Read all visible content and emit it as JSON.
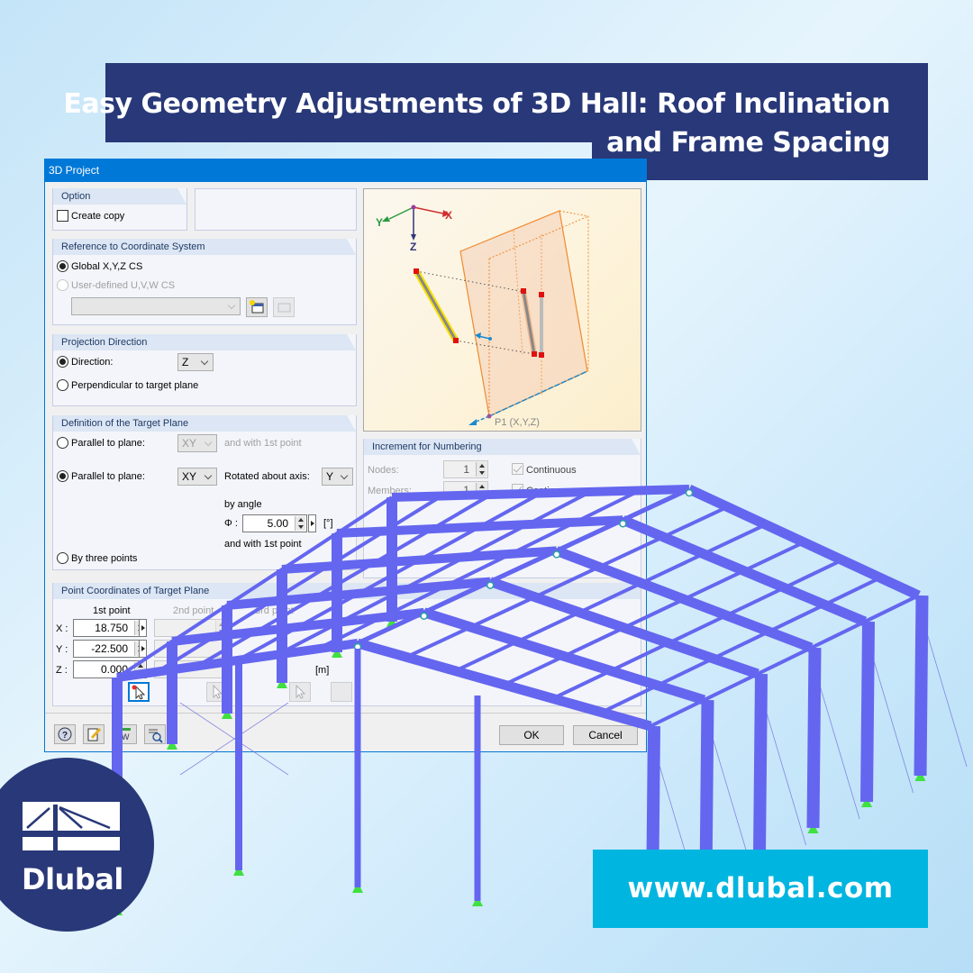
{
  "banner": {
    "line1": "Easy Geometry Adjustments of 3D Hall: Roof Inclination",
    "line2": "and Frame Spacing"
  },
  "dialog": {
    "title": "3D Project",
    "option": {
      "heading": "Option",
      "create_copy_label": "Create copy",
      "create_copy_checked": false
    },
    "coordinate_system": {
      "heading": "Reference to Coordinate System",
      "global_label": "Global X,Y,Z CS",
      "user_defined_label": "User-defined U,V,W CS",
      "selected": "global",
      "cs_select_value": ""
    },
    "projection": {
      "heading": "Projection Direction",
      "direction_label": "Direction:",
      "direction_value": "Z",
      "perpendicular_label": "Perpendicular to target plane",
      "selected": "direction"
    },
    "target_plane": {
      "heading": "Definition of the Target Plane",
      "option1_label": "Parallel to plane:",
      "option1_plane": "XY",
      "option1_suffix": "and with 1st point",
      "option2_label": "Parallel to plane:",
      "option2_plane": "XY",
      "rotated_label": "Rotated about axis:",
      "rotated_axis": "Y",
      "by_angle_label": "by angle",
      "phi_label": "Φ :",
      "angle_value": "5.00",
      "angle_unit": "[°]",
      "and_with_label": "and with 1st point",
      "option3_label": "By three points",
      "selected": "option2"
    },
    "point_coordinates": {
      "heading": "Point Coordinates of Target Plane",
      "columns": [
        "1st point",
        "2nd point",
        "3rd point"
      ],
      "rows": [
        {
          "axis": "X :",
          "p1": "18.750",
          "p2": "",
          "p3": ""
        },
        {
          "axis": "Y :",
          "p1": "-22.500",
          "p2": "",
          "p3": ""
        },
        {
          "axis": "Z :",
          "p1": "0.000",
          "p2": "",
          "p3": ""
        }
      ],
      "unit": "[m]"
    },
    "preview": {
      "axis_x": "X",
      "axis_y": "Y",
      "axis_z": "Z",
      "point_label": "P1 (X,Y,Z)"
    },
    "numbering": {
      "heading": "Increment for Numbering",
      "nodes_label": "Nodes:",
      "nodes_value": "1",
      "members_label": "Members:",
      "members_value": "1",
      "continuous_label": "Continuous",
      "nodes_continuous": true,
      "members_continuous": true
    },
    "buttons": {
      "ok": "OK",
      "cancel": "Cancel"
    }
  },
  "colors": {
    "brand_navy": "#283878",
    "brand_cyan": "#00b5e0",
    "member_blue": "#6466f0",
    "titlebar": "#0078d7"
  },
  "logo": {
    "text": "Dlubal"
  },
  "website": {
    "url": "www.dlubal.com"
  }
}
